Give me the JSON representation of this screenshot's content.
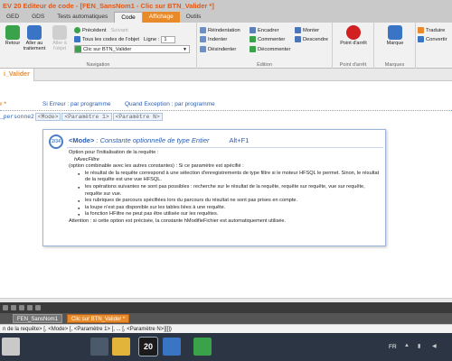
{
  "title": "EV 20 Editeur de code - [FEN_SansNom1 - Clic sur BTN_Valider *]",
  "menu_tabs": [
    "GED",
    "GDS",
    "Tests automatiques",
    "Code",
    "Affichage",
    "Outils"
  ],
  "ribbon": {
    "nav_group_label": "Navigation",
    "retour": "Retour",
    "aller_traitement": "Aller au traitement",
    "aller_objet": "Aller à l'objet",
    "precedent": "Précédent",
    "suivant": "Suivant",
    "tous_codes": "Tous les codes de l'objet",
    "ligne_label": "Ligne :",
    "ligne_value": "1",
    "event_value": "Clic sur BTN_Valider",
    "edition_group_label": "Édition",
    "reindentation": "Réindentation",
    "indenter": "Indenter",
    "desindenter": "Désindenter",
    "encadrer": "Encadrer",
    "commenter": "Commenter",
    "decommenter": "Décommenter",
    "monter": "Monter",
    "descendre": "Descendre",
    "point_arret": "Point d'arrêt",
    "point_arret_group": "Point d'arrêt",
    "marque": "Marque",
    "marques_group": "Marques",
    "traduire": "Traduire",
    "convertir": "Convertir"
  },
  "panel": {
    "tab_label": "i_Valider"
  },
  "editor": {
    "left_label": "r *",
    "si_erreur": "Si Erreur : par programme",
    "quand_exception": "Quand Exception : par programme",
    "code_var": "_personne2",
    "code_hint_1": "<Mode>",
    "code_hint_2": "<Paramètre 1>",
    "code_hint_3": "<Paramètre N>"
  },
  "popup": {
    "badge": "2/34",
    "title_mode": "<Mode>",
    "title_desc": " : Constante optionnelle de type Entier",
    "shortcut": "Alt+F1",
    "lines": [
      {
        "t": "Option pour l'initialisation de la requête :",
        "k": "p"
      },
      {
        "t": "hAvecFiltre",
        "k": "i"
      },
      {
        "t": "(option combinable avec les autres constantes) :    Si ce paramètre est spécifié :",
        "k": "p"
      },
      {
        "t": "le résultat de la requête correspond à une sélection d'enregistrements de type filtre si le moteur HFSQL le permet. Sinon, le résultat de la requête est une vue HFSQL.",
        "k": "b"
      },
      {
        "t": "les opérations suivantes ne sont pas possibles : recherche sur le résultat de la requête, requête sur requête, vue sur requête, requête sur vue.",
        "k": "b"
      },
      {
        "t": "les rubriques de parcours spécifiées lors du parcours du résultat ne sont pas prises en compte.",
        "k": "b"
      },
      {
        "t": "la loupe n'est pas disponible sur les tables liées à une requête.",
        "k": "b"
      },
      {
        "t": "la fonction HFiltre ne peut pas être utilisée sur les requêtes.",
        "k": "b"
      },
      {
        "t": "Attention : si cette option est précisée, la constante hModifieFichier est automatiquement utilisée.",
        "k": "p"
      }
    ]
  },
  "doc_tabs": [
    "FEN_SansNom1",
    "Clic sur BTN_Valider *"
  ],
  "hint_bar": "n de la requête> [, <Mode> [, <Paramètre 1> [, ... [, <Paramètre N>]]]])",
  "taskbar": {
    "lang": "FR",
    "app20": "20",
    "colors": {
      "bg": "#2b3543",
      "accent": "#e88a2a"
    }
  },
  "colors": {
    "accent": "#e88a2a",
    "link": "#2a5db0",
    "ribbon_bg": "#f1f1f1"
  }
}
